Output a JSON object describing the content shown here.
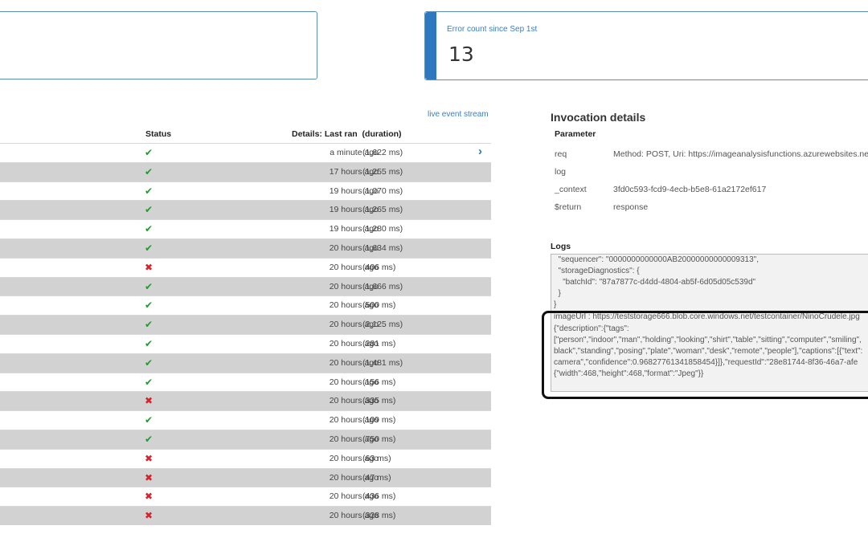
{
  "error_card": {
    "label": "Error count since Sep 1st",
    "value": "13"
  },
  "links": {
    "live_event_stream": "live event stream"
  },
  "table": {
    "headers": {
      "status": "Status",
      "details": "Details: Last ran",
      "duration": "(duration)"
    },
    "rows": [
      {
        "status": "success",
        "ago": "a minute ago",
        "duration": "(1,622 ms)"
      },
      {
        "status": "success",
        "ago": "17 hours ago",
        "duration": "(1,255 ms)"
      },
      {
        "status": "success",
        "ago": "19 hours ago",
        "duration": "(1,070 ms)"
      },
      {
        "status": "success",
        "ago": "19 hours ago",
        "duration": "(1,265 ms)"
      },
      {
        "status": "success",
        "ago": "19 hours ago",
        "duration": "(1,280 ms)"
      },
      {
        "status": "success",
        "ago": "20 hours ago",
        "duration": "(1,634 ms)"
      },
      {
        "status": "failure",
        "ago": "20 hours ago",
        "duration": "(406 ms)"
      },
      {
        "status": "success",
        "ago": "20 hours ago",
        "duration": "(1,666 ms)"
      },
      {
        "status": "success",
        "ago": "20 hours ago",
        "duration": "(500 ms)"
      },
      {
        "status": "success",
        "ago": "20 hours ago",
        "duration": "(2,125 ms)"
      },
      {
        "status": "success",
        "ago": "20 hours ago",
        "duration": "(281 ms)"
      },
      {
        "status": "success",
        "ago": "20 hours ago",
        "duration": "(1,481 ms)"
      },
      {
        "status": "success",
        "ago": "20 hours ago",
        "duration": "(156 ms)"
      },
      {
        "status": "failure",
        "ago": "20 hours ago",
        "duration": "(335 ms)"
      },
      {
        "status": "success",
        "ago": "20 hours ago",
        "duration": "(109 ms)"
      },
      {
        "status": "success",
        "ago": "20 hours ago",
        "duration": "(750 ms)"
      },
      {
        "status": "failure",
        "ago": "20 hours ago",
        "duration": "(63 ms)"
      },
      {
        "status": "failure",
        "ago": "20 hours ago",
        "duration": "(47 ms)"
      },
      {
        "status": "failure",
        "ago": "20 hours ago",
        "duration": "(436 ms)"
      },
      {
        "status": "failure",
        "ago": "20 hours ago",
        "duration": "(328 ms)"
      }
    ],
    "status_colors": {
      "success": "#1f9a2e",
      "failure": "#d9222b"
    },
    "icons": {
      "success": "checkmark-icon",
      "failure": "cross-icon",
      "open": "chevron-right-icon"
    }
  },
  "invocation": {
    "title": "Invocation details",
    "param_header": "Parameter",
    "params": [
      {
        "name": "req",
        "value": "Method: POST, Uri: https://imageanalysisfunctions.azurewebsites.net"
      },
      {
        "name": "log",
        "value": ""
      },
      {
        "name": "_context",
        "value": "3fd0c593-fcd9-4ecb-b5e8-61a2172ef617"
      },
      {
        "name": "$return",
        "value": "response"
      }
    ]
  },
  "logs": {
    "title": "Logs",
    "lines": [
      "  \"sequencer\": \"0000000000000AB20000000000009313\",",
      "  \"storageDiagnostics\": {",
      "    \"batchId\": \"87a7877c-d4dd-4804-ab5f-6d05d05c539d\"",
      "  }",
      "}",
      "imageUrl : https://teststorage666.blob.core.windows.net/testcontainer/NinoCrudele.jpg",
      "{\"description\":{\"tags\":",
      "[\"person\",\"indoor\",\"man\",\"holding\",\"looking\",\"shirt\",\"table\",\"sitting\",\"computer\",\"smiling\",",
      "black\",\"standing\",\"posing\",\"plate\",\"woman\",\"desk\",\"remote\",\"people\"],\"captions\":[{\"text\":",
      "camera\",\"confidence\":0.96827761341858454}]},\"requestId\":\"28e81744-8f36-46a7-afe",
      "{\"width\":468,\"height\":468,\"format\":\"Jpeg\"}}"
    ]
  }
}
